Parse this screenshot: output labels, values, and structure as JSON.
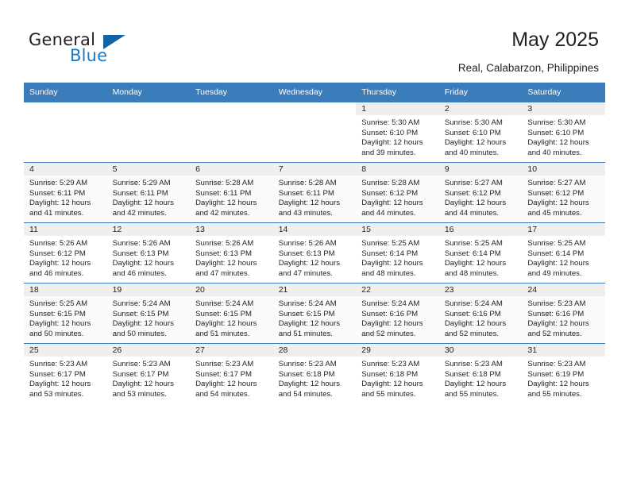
{
  "brand": {
    "name_top": "General",
    "name_bottom": "Blue",
    "accent_color": "#1364a6",
    "blue_text_color": "#1a7ac4"
  },
  "header": {
    "title": "May 2025",
    "subtitle": "Real, Calabarzon, Philippines",
    "header_bg_color": "#3b7cba"
  },
  "calendar": {
    "weekday_headers": [
      "Sunday",
      "Monday",
      "Tuesday",
      "Wednesday",
      "Thursday",
      "Friday",
      "Saturday"
    ],
    "labels": {
      "sunrise_prefix": "Sunrise:",
      "sunset_prefix": "Sunset:",
      "daylight_prefix": "Daylight:"
    },
    "weeks": [
      [
        {
          "day": "",
          "sunrise": "",
          "sunset": "",
          "daylight": "",
          "empty": true
        },
        {
          "day": "",
          "sunrise": "",
          "sunset": "",
          "daylight": "",
          "empty": true
        },
        {
          "day": "",
          "sunrise": "",
          "sunset": "",
          "daylight": "",
          "empty": true
        },
        {
          "day": "",
          "sunrise": "",
          "sunset": "",
          "daylight": "",
          "empty": true
        },
        {
          "day": "1",
          "sunrise": "Sunrise: 5:30 AM",
          "sunset": "Sunset: 6:10 PM",
          "daylight": "Daylight: 12 hours and 39 minutes.",
          "empty": false
        },
        {
          "day": "2",
          "sunrise": "Sunrise: 5:30 AM",
          "sunset": "Sunset: 6:10 PM",
          "daylight": "Daylight: 12 hours and 40 minutes.",
          "empty": false
        },
        {
          "day": "3",
          "sunrise": "Sunrise: 5:30 AM",
          "sunset": "Sunset: 6:10 PM",
          "daylight": "Daylight: 12 hours and 40 minutes.",
          "empty": false
        }
      ],
      [
        {
          "day": "4",
          "sunrise": "Sunrise: 5:29 AM",
          "sunset": "Sunset: 6:11 PM",
          "daylight": "Daylight: 12 hours and 41 minutes.",
          "empty": false
        },
        {
          "day": "5",
          "sunrise": "Sunrise: 5:29 AM",
          "sunset": "Sunset: 6:11 PM",
          "daylight": "Daylight: 12 hours and 42 minutes.",
          "empty": false
        },
        {
          "day": "6",
          "sunrise": "Sunrise: 5:28 AM",
          "sunset": "Sunset: 6:11 PM",
          "daylight": "Daylight: 12 hours and 42 minutes.",
          "empty": false
        },
        {
          "day": "7",
          "sunrise": "Sunrise: 5:28 AM",
          "sunset": "Sunset: 6:11 PM",
          "daylight": "Daylight: 12 hours and 43 minutes.",
          "empty": false
        },
        {
          "day": "8",
          "sunrise": "Sunrise: 5:28 AM",
          "sunset": "Sunset: 6:12 PM",
          "daylight": "Daylight: 12 hours and 44 minutes.",
          "empty": false
        },
        {
          "day": "9",
          "sunrise": "Sunrise: 5:27 AM",
          "sunset": "Sunset: 6:12 PM",
          "daylight": "Daylight: 12 hours and 44 minutes.",
          "empty": false
        },
        {
          "day": "10",
          "sunrise": "Sunrise: 5:27 AM",
          "sunset": "Sunset: 6:12 PM",
          "daylight": "Daylight: 12 hours and 45 minutes.",
          "empty": false
        }
      ],
      [
        {
          "day": "11",
          "sunrise": "Sunrise: 5:26 AM",
          "sunset": "Sunset: 6:12 PM",
          "daylight": "Daylight: 12 hours and 46 minutes.",
          "empty": false
        },
        {
          "day": "12",
          "sunrise": "Sunrise: 5:26 AM",
          "sunset": "Sunset: 6:13 PM",
          "daylight": "Daylight: 12 hours and 46 minutes.",
          "empty": false
        },
        {
          "day": "13",
          "sunrise": "Sunrise: 5:26 AM",
          "sunset": "Sunset: 6:13 PM",
          "daylight": "Daylight: 12 hours and 47 minutes.",
          "empty": false
        },
        {
          "day": "14",
          "sunrise": "Sunrise: 5:26 AM",
          "sunset": "Sunset: 6:13 PM",
          "daylight": "Daylight: 12 hours and 47 minutes.",
          "empty": false
        },
        {
          "day": "15",
          "sunrise": "Sunrise: 5:25 AM",
          "sunset": "Sunset: 6:14 PM",
          "daylight": "Daylight: 12 hours and 48 minutes.",
          "empty": false
        },
        {
          "day": "16",
          "sunrise": "Sunrise: 5:25 AM",
          "sunset": "Sunset: 6:14 PM",
          "daylight": "Daylight: 12 hours and 48 minutes.",
          "empty": false
        },
        {
          "day": "17",
          "sunrise": "Sunrise: 5:25 AM",
          "sunset": "Sunset: 6:14 PM",
          "daylight": "Daylight: 12 hours and 49 minutes.",
          "empty": false
        }
      ],
      [
        {
          "day": "18",
          "sunrise": "Sunrise: 5:25 AM",
          "sunset": "Sunset: 6:15 PM",
          "daylight": "Daylight: 12 hours and 50 minutes.",
          "empty": false
        },
        {
          "day": "19",
          "sunrise": "Sunrise: 5:24 AM",
          "sunset": "Sunset: 6:15 PM",
          "daylight": "Daylight: 12 hours and 50 minutes.",
          "empty": false
        },
        {
          "day": "20",
          "sunrise": "Sunrise: 5:24 AM",
          "sunset": "Sunset: 6:15 PM",
          "daylight": "Daylight: 12 hours and 51 minutes.",
          "empty": false
        },
        {
          "day": "21",
          "sunrise": "Sunrise: 5:24 AM",
          "sunset": "Sunset: 6:15 PM",
          "daylight": "Daylight: 12 hours and 51 minutes.",
          "empty": false
        },
        {
          "day": "22",
          "sunrise": "Sunrise: 5:24 AM",
          "sunset": "Sunset: 6:16 PM",
          "daylight": "Daylight: 12 hours and 52 minutes.",
          "empty": false
        },
        {
          "day": "23",
          "sunrise": "Sunrise: 5:24 AM",
          "sunset": "Sunset: 6:16 PM",
          "daylight": "Daylight: 12 hours and 52 minutes.",
          "empty": false
        },
        {
          "day": "24",
          "sunrise": "Sunrise: 5:23 AM",
          "sunset": "Sunset: 6:16 PM",
          "daylight": "Daylight: 12 hours and 52 minutes.",
          "empty": false
        }
      ],
      [
        {
          "day": "25",
          "sunrise": "Sunrise: 5:23 AM",
          "sunset": "Sunset: 6:17 PM",
          "daylight": "Daylight: 12 hours and 53 minutes.",
          "empty": false
        },
        {
          "day": "26",
          "sunrise": "Sunrise: 5:23 AM",
          "sunset": "Sunset: 6:17 PM",
          "daylight": "Daylight: 12 hours and 53 minutes.",
          "empty": false
        },
        {
          "day": "27",
          "sunrise": "Sunrise: 5:23 AM",
          "sunset": "Sunset: 6:17 PM",
          "daylight": "Daylight: 12 hours and 54 minutes.",
          "empty": false
        },
        {
          "day": "28",
          "sunrise": "Sunrise: 5:23 AM",
          "sunset": "Sunset: 6:18 PM",
          "daylight": "Daylight: 12 hours and 54 minutes.",
          "empty": false
        },
        {
          "day": "29",
          "sunrise": "Sunrise: 5:23 AM",
          "sunset": "Sunset: 6:18 PM",
          "daylight": "Daylight: 12 hours and 55 minutes.",
          "empty": false
        },
        {
          "day": "30",
          "sunrise": "Sunrise: 5:23 AM",
          "sunset": "Sunset: 6:18 PM",
          "daylight": "Daylight: 12 hours and 55 minutes.",
          "empty": false
        },
        {
          "day": "31",
          "sunrise": "Sunrise: 5:23 AM",
          "sunset": "Sunset: 6:19 PM",
          "daylight": "Daylight: 12 hours and 55 minutes.",
          "empty": false
        }
      ]
    ]
  }
}
